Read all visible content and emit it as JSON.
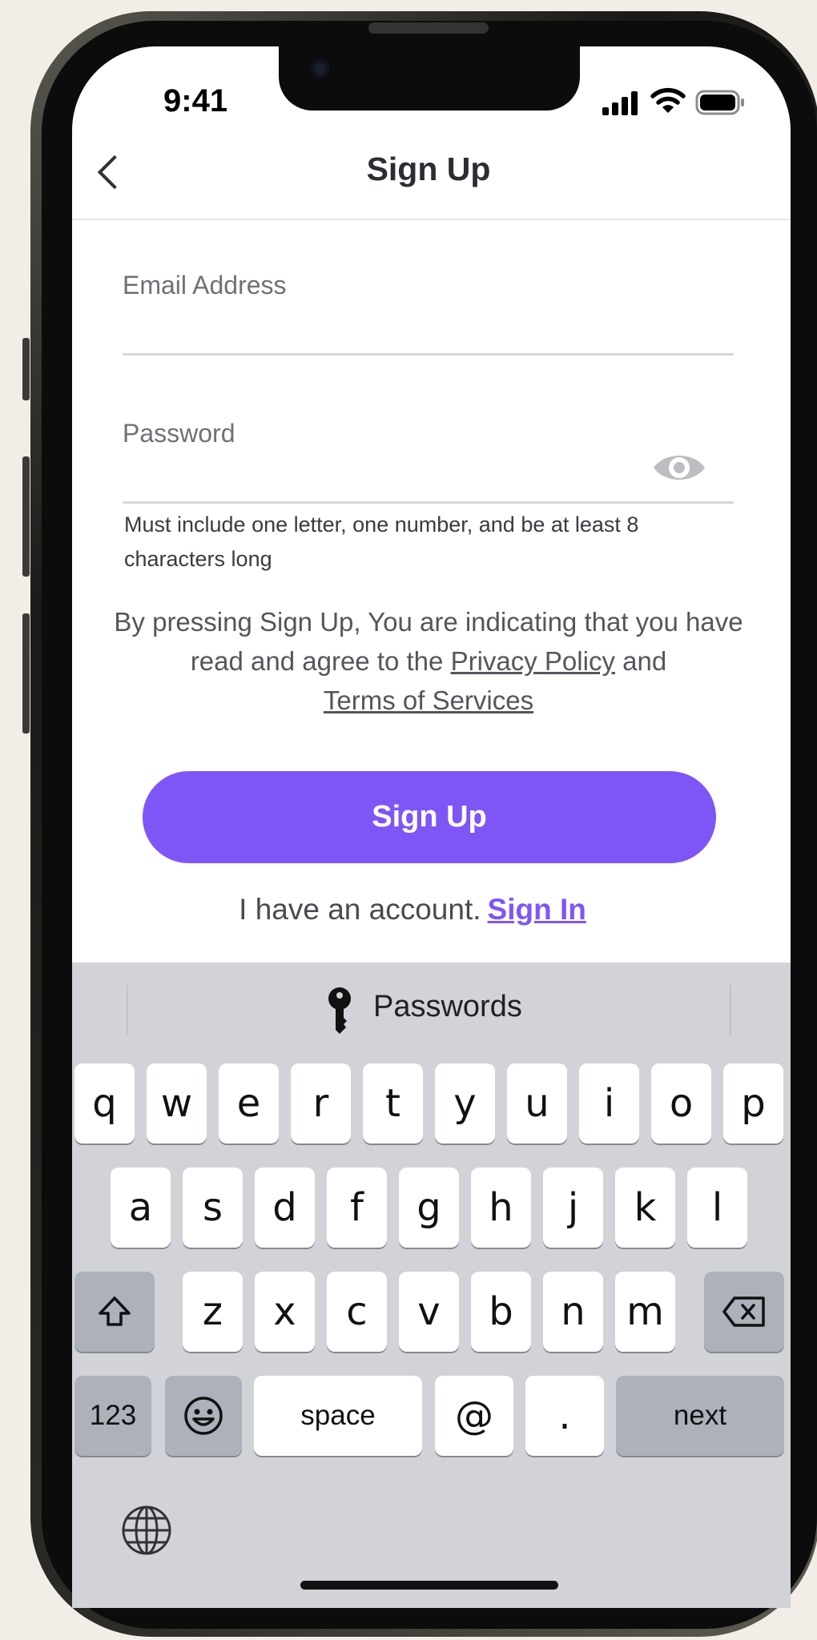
{
  "status_bar": {
    "time": "9:41"
  },
  "nav": {
    "title": "Sign Up"
  },
  "form": {
    "email_label": "Email Address",
    "password_label": "Password",
    "password_hint": "Must include one letter, one number, and be at least 8 characters long"
  },
  "terms": {
    "prefix": "By pressing Sign Up, You are indicating that you have read and agree to the ",
    "privacy_link": "Privacy Policy",
    "middle": " and ",
    "terms_link": "Terms of Services"
  },
  "signup_button": "Sign Up",
  "account": {
    "text": "I have an account.",
    "signin_link": "Sign In"
  },
  "keyboard": {
    "suggestion": "Passwords",
    "row1": [
      "q",
      "w",
      "e",
      "r",
      "t",
      "y",
      "u",
      "i",
      "o",
      "p"
    ],
    "row2": [
      "a",
      "s",
      "d",
      "f",
      "g",
      "h",
      "j",
      "k",
      "l"
    ],
    "row3": [
      "z",
      "x",
      "c",
      "v",
      "b",
      "n",
      "m"
    ],
    "numbers_key": "123",
    "space_key": "space",
    "at_key": "@",
    "dot_key": ".",
    "next_key": "next"
  },
  "icons": [
    "back-chevron-icon",
    "signal-icon",
    "wifi-icon",
    "battery-icon",
    "eye-icon",
    "key-icon",
    "shift-icon",
    "backspace-icon",
    "emoji-icon",
    "globe-icon"
  ],
  "colors": {
    "accent": "#7f56f6",
    "keyboard_bg": "#d1d3d9"
  }
}
